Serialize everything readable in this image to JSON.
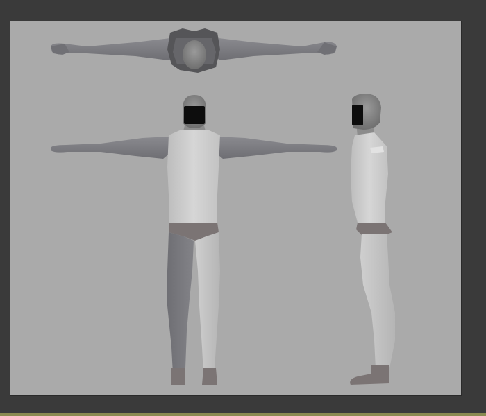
{
  "viewport": {
    "background_color": "#aaaaaa",
    "views": [
      "top-view",
      "front-view",
      "side-view"
    ]
  },
  "model": {
    "shirt_color": "#cfcfcf",
    "pants_color": "#7b7474",
    "skin_color": "#7f7f84",
    "leg_color": "#c4c4c4",
    "head_color": "#8c8c8c",
    "visor_color": "#0d0d0d"
  },
  "app_colors": {
    "frame_background": "#3a3a3a",
    "bottom_strip": "#8a8a50"
  }
}
